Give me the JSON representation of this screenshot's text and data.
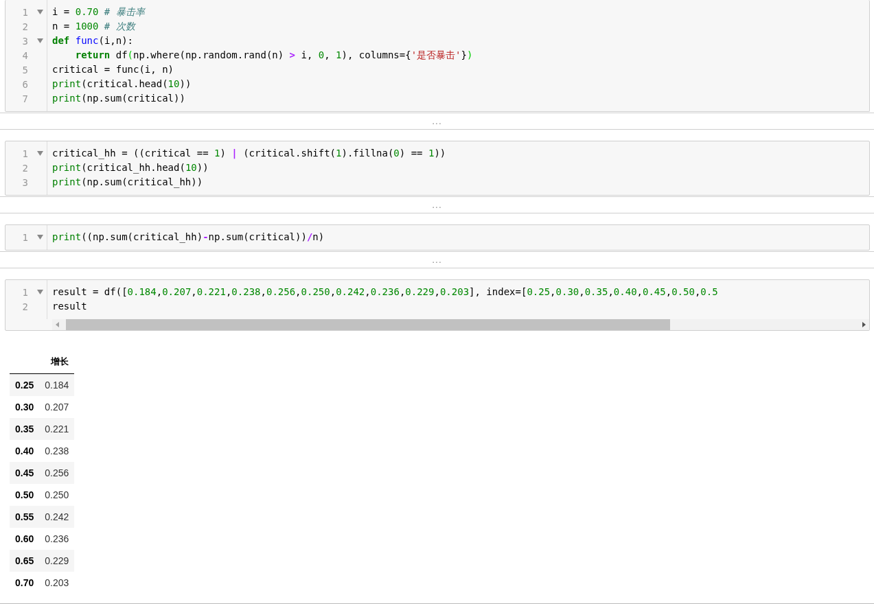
{
  "cells": [
    {
      "scrollbar": false,
      "lines": [
        {
          "number": "1",
          "foldable": true,
          "tokens": [
            {
              "kind": "plain",
              "text": "i = "
            },
            {
              "kind": "number",
              "text": "0.70"
            },
            {
              "kind": "comment",
              "text": " # 暴击率"
            }
          ]
        },
        {
          "number": "2",
          "foldable": false,
          "tokens": [
            {
              "kind": "plain",
              "text": "n = "
            },
            {
              "kind": "number",
              "text": "1000"
            },
            {
              "kind": "comment",
              "text": " # 次数"
            }
          ]
        },
        {
          "number": "3",
          "foldable": true,
          "tokens": [
            {
              "kind": "keyword",
              "text": "def"
            },
            {
              "kind": "defname",
              "text": " func"
            },
            {
              "kind": "plain",
              "text": "(i,n):"
            }
          ]
        },
        {
          "number": "4",
          "foldable": false,
          "tokens": [
            {
              "kind": "keyword",
              "text": "    return"
            },
            {
              "kind": "plain",
              "text": " df"
            },
            {
              "kind": "match",
              "text": "("
            },
            {
              "kind": "plain",
              "text": "np.where(np.random.rand(n) "
            },
            {
              "kind": "operator",
              "text": ">"
            },
            {
              "kind": "plain",
              "text": " i, "
            },
            {
              "kind": "number",
              "text": "0"
            },
            {
              "kind": "plain",
              "text": ", "
            },
            {
              "kind": "number",
              "text": "1"
            },
            {
              "kind": "plain",
              "text": "), columns={"
            },
            {
              "kind": "string",
              "text": "'是否暴击'"
            },
            {
              "kind": "plain",
              "text": "}"
            },
            {
              "kind": "match",
              "text": ")"
            }
          ]
        },
        {
          "number": "5",
          "foldable": false,
          "tokens": [
            {
              "kind": "plain",
              "text": "critical = func(i, n)"
            }
          ]
        },
        {
          "number": "6",
          "foldable": false,
          "tokens": [
            {
              "kind": "builtin",
              "text": "print"
            },
            {
              "kind": "plain",
              "text": "(critical.head("
            },
            {
              "kind": "number",
              "text": "10"
            },
            {
              "kind": "plain",
              "text": "))"
            }
          ]
        },
        {
          "number": "7",
          "foldable": false,
          "tokens": [
            {
              "kind": "builtin",
              "text": "print"
            },
            {
              "kind": "plain",
              "text": "(np.sum(critical))"
            }
          ]
        }
      ],
      "output": {
        "kind": "collapsed",
        "text": "..."
      }
    },
    {
      "scrollbar": false,
      "lines": [
        {
          "number": "1",
          "foldable": true,
          "tokens": [
            {
              "kind": "plain",
              "text": "critical_hh = ((critical == "
            },
            {
              "kind": "number",
              "text": "1"
            },
            {
              "kind": "plain",
              "text": ") "
            },
            {
              "kind": "operator",
              "text": "|"
            },
            {
              "kind": "plain",
              "text": " (critical.shift("
            },
            {
              "kind": "number",
              "text": "1"
            },
            {
              "kind": "plain",
              "text": ").fillna("
            },
            {
              "kind": "number",
              "text": "0"
            },
            {
              "kind": "plain",
              "text": ") == "
            },
            {
              "kind": "number",
              "text": "1"
            },
            {
              "kind": "plain",
              "text": "))"
            }
          ]
        },
        {
          "number": "2",
          "foldable": false,
          "tokens": [
            {
              "kind": "builtin",
              "text": "print"
            },
            {
              "kind": "plain",
              "text": "(critical_hh.head("
            },
            {
              "kind": "number",
              "text": "10"
            },
            {
              "kind": "plain",
              "text": "))"
            }
          ]
        },
        {
          "number": "3",
          "foldable": false,
          "tokens": [
            {
              "kind": "builtin",
              "text": "print"
            },
            {
              "kind": "plain",
              "text": "(np.sum(critical_hh))"
            }
          ]
        }
      ],
      "output": {
        "kind": "collapsed",
        "text": "..."
      }
    },
    {
      "scrollbar": false,
      "lines": [
        {
          "number": "1",
          "foldable": true,
          "tokens": [
            {
              "kind": "builtin",
              "text": "print"
            },
            {
              "kind": "plain",
              "text": "((np.sum(critical_hh)"
            },
            {
              "kind": "operator",
              "text": "-"
            },
            {
              "kind": "plain",
              "text": "np.sum(critical))"
            },
            {
              "kind": "operator",
              "text": "/"
            },
            {
              "kind": "plain",
              "text": "n)"
            }
          ]
        }
      ],
      "output": {
        "kind": "collapsed",
        "text": "..."
      }
    },
    {
      "scrollbar": true,
      "lines": [
        {
          "number": "1",
          "foldable": true,
          "tokens": [
            {
              "kind": "plain",
              "text": "result = df(["
            },
            {
              "kind": "number",
              "text": "0.184"
            },
            {
              "kind": "plain",
              "text": ","
            },
            {
              "kind": "number",
              "text": "0.207"
            },
            {
              "kind": "plain",
              "text": ","
            },
            {
              "kind": "number",
              "text": "0.221"
            },
            {
              "kind": "plain",
              "text": ","
            },
            {
              "kind": "number",
              "text": "0.238"
            },
            {
              "kind": "plain",
              "text": ","
            },
            {
              "kind": "number",
              "text": "0.256"
            },
            {
              "kind": "plain",
              "text": ","
            },
            {
              "kind": "number",
              "text": "0.250"
            },
            {
              "kind": "plain",
              "text": ","
            },
            {
              "kind": "number",
              "text": "0.242"
            },
            {
              "kind": "plain",
              "text": ","
            },
            {
              "kind": "number",
              "text": "0.236"
            },
            {
              "kind": "plain",
              "text": ","
            },
            {
              "kind": "number",
              "text": "0.229"
            },
            {
              "kind": "plain",
              "text": ","
            },
            {
              "kind": "number",
              "text": "0.203"
            },
            {
              "kind": "plain",
              "text": "], index=["
            },
            {
              "kind": "number",
              "text": "0.25"
            },
            {
              "kind": "plain",
              "text": ","
            },
            {
              "kind": "number",
              "text": "0.30"
            },
            {
              "kind": "plain",
              "text": ","
            },
            {
              "kind": "number",
              "text": "0.35"
            },
            {
              "kind": "plain",
              "text": ","
            },
            {
              "kind": "number",
              "text": "0.40"
            },
            {
              "kind": "plain",
              "text": ","
            },
            {
              "kind": "number",
              "text": "0.45"
            },
            {
              "kind": "plain",
              "text": ","
            },
            {
              "kind": "number",
              "text": "0.50"
            },
            {
              "kind": "plain",
              "text": ","
            },
            {
              "kind": "number",
              "text": "0.5"
            }
          ]
        },
        {
          "number": "2",
          "foldable": false,
          "tokens": [
            {
              "kind": "plain",
              "text": "result"
            }
          ]
        }
      ],
      "output": {
        "kind": "table",
        "header": "增长",
        "rows": [
          {
            "index": "0.25",
            "value": "0.184"
          },
          {
            "index": "0.30",
            "value": "0.207"
          },
          {
            "index": "0.35",
            "value": "0.221"
          },
          {
            "index": "0.40",
            "value": "0.238"
          },
          {
            "index": "0.45",
            "value": "0.256"
          },
          {
            "index": "0.50",
            "value": "0.250"
          },
          {
            "index": "0.55",
            "value": "0.242"
          },
          {
            "index": "0.60",
            "value": "0.236"
          },
          {
            "index": "0.65",
            "value": "0.229"
          },
          {
            "index": "0.70",
            "value": "0.203"
          }
        ]
      }
    }
  ]
}
